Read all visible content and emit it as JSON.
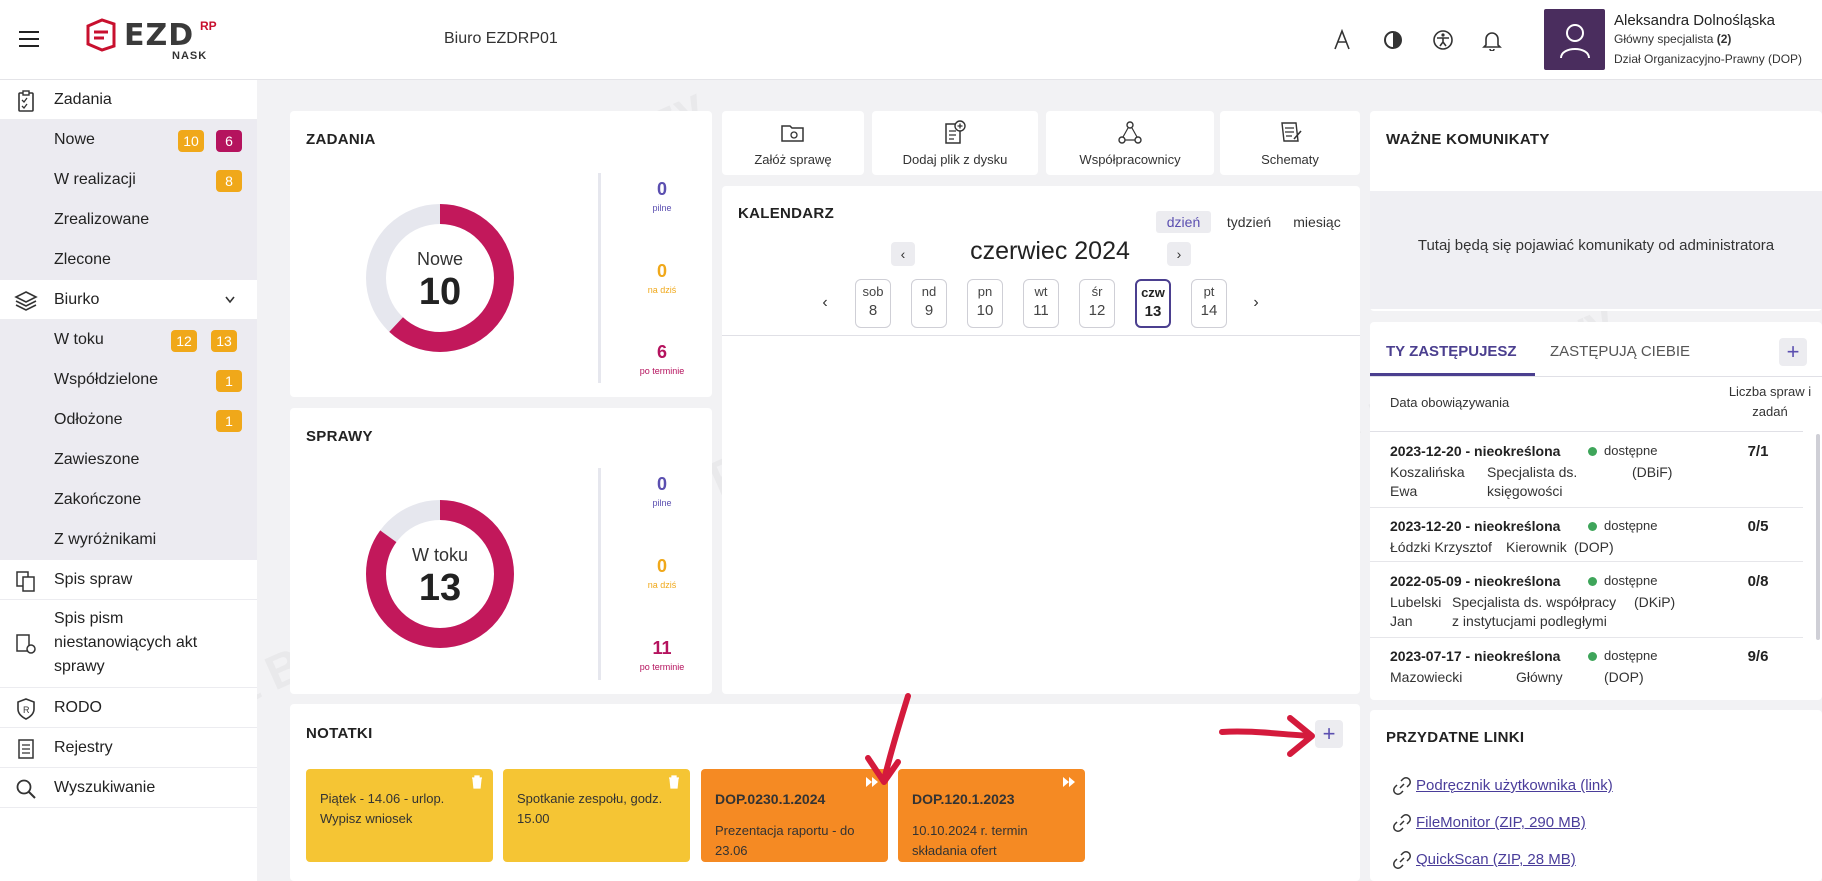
{
  "header": {
    "office": "Biuro EZDRP01",
    "logo_text": "EZD",
    "logo_rp": "RP",
    "logo_nask": "NASK",
    "user_name": "Aleksandra Dolnośląska",
    "user_role_prefix": "Główny specjalista ",
    "user_role_count": "(2)",
    "user_dept": "Dział Organizacyjno-Prawny (DOP)",
    "icons": [
      "font-size-icon",
      "contrast-icon",
      "accessibility-icon",
      "bell-icon"
    ]
  },
  "sidebar": {
    "zadania": "Zadania",
    "zadania_items": [
      {
        "label": "Nowe",
        "badge1": "10",
        "badge2": "6"
      },
      {
        "label": "W realizacji",
        "badge1": "8"
      },
      {
        "label": "Zrealizowane"
      },
      {
        "label": "Zlecone"
      }
    ],
    "biurko": "Biurko",
    "biurko_items": [
      {
        "label": "W toku",
        "badge1": "12",
        "badge2": "13"
      },
      {
        "label": "Współdzielone",
        "badge1": "1"
      },
      {
        "label": "Odłożone",
        "badge1": "1"
      },
      {
        "label": "Zawieszone"
      },
      {
        "label": "Zakończone"
      },
      {
        "label": "Z wyróżnikami"
      }
    ],
    "spis_spraw": "Spis spraw",
    "spis_pism_1": "Spis pism",
    "spis_pism_2": "niestanowiących akt",
    "spis_pism_3": "sprawy",
    "rodo": "RODO",
    "rejestry": "Rejestry",
    "wyszukiwanie": "Wyszukiwanie"
  },
  "zadania": {
    "title": "ZADANIA",
    "donut_label": "Nowe",
    "donut_value": "10",
    "donut_fraction": 0.62,
    "stats": [
      {
        "value": "0",
        "label": "pilne"
      },
      {
        "value": "0",
        "label": "na dziś"
      },
      {
        "value": "6",
        "label": "po terminie"
      }
    ]
  },
  "sprawy": {
    "title": "SPRAWY",
    "donut_label": "W toku",
    "donut_value": "13",
    "donut_fraction": 0.85,
    "stats": [
      {
        "value": "0",
        "label": "pilne"
      },
      {
        "value": "0",
        "label": "na dziś"
      },
      {
        "value": "11",
        "label": "po terminie"
      }
    ]
  },
  "quick_actions": [
    {
      "label": "Załóż sprawę"
    },
    {
      "label": "Dodaj plik z dysku"
    },
    {
      "label": "Współpracownicy"
    },
    {
      "label": "Schematy"
    }
  ],
  "kalendarz": {
    "title": "KALENDARZ",
    "views": [
      "dzień",
      "tydzień",
      "miesiąc"
    ],
    "month": "czerwiec 2024",
    "days": [
      {
        "name": "sob",
        "num": "8"
      },
      {
        "name": "nd",
        "num": "9"
      },
      {
        "name": "pn",
        "num": "10"
      },
      {
        "name": "wt",
        "num": "11"
      },
      {
        "name": "śr",
        "num": "12"
      },
      {
        "name": "czw",
        "num": "13"
      },
      {
        "name": "pt",
        "num": "14"
      }
    ]
  },
  "notatki": {
    "title": "NOTATKI",
    "notes": [
      {
        "line1": "Piątek - 14.06 - urlop.",
        "line2": "Wypisz wniosek"
      },
      {
        "line1": "Spotkanie zespołu, godz.",
        "line2": "15.00"
      },
      {
        "head": "DOP.0230.1.2024",
        "line1": "Prezentacja raportu - do",
        "line2": "23.06"
      },
      {
        "head": "DOP.120.1.2023",
        "line1": "10.10.2024 r. termin",
        "line2": "składania ofert"
      }
    ]
  },
  "komunikaty": {
    "title": "WAŻNE KOMUNIKATY",
    "message": "Tutaj będą się pojawiać komunikaty od administratora"
  },
  "zastepstwa": {
    "tab_active": "TY ZASTĘPUJESZ",
    "tab_other": "ZASTĘPUJĄ CIEBIE",
    "col_date": "Data obowiązywania",
    "col_count_1": "Liczba spraw i",
    "col_count_2": "zadań",
    "rows": [
      {
        "date": "2023-12-20 - nieokreślona",
        "status": "dostępne",
        "name1": "Koszalińska",
        "name2": "Ewa",
        "role1": "Specjalista ds.",
        "role2": "księgowości",
        "unit": "(DBiF)",
        "count": "7/1"
      },
      {
        "date": "2023-12-20 - nieokreślona",
        "status": "dostępne",
        "name1": "Łódzki Krzysztof",
        "role1": "Kierownik",
        "unit": "(DOP)",
        "count": "0/5"
      },
      {
        "date": "2022-05-09 - nieokreślona",
        "status": "dostępne",
        "name1": "Lubelski",
        "name2": "Jan",
        "role1": "Specjalista ds. współpracy",
        "role2": "z instytucjami podległymi",
        "unit": "(DKiP)",
        "count": "0/8"
      },
      {
        "date": "2023-07-17 - nieokreślona",
        "status": "dostępne",
        "name1": "Mazowiecki",
        "role1": "Główny",
        "unit": "(DOP)",
        "count": "9/6"
      }
    ]
  },
  "linki": {
    "title": "PRZYDATNE LINKI",
    "items": [
      "Podręcznik użytkownika (link)",
      "FileMonitor (ZIP, 290 MB)",
      "QuickScan (ZIP, 28 MB)"
    ]
  },
  "colors": {
    "magenta": "#c2185b",
    "yellow": "#f0a81a",
    "orange": "#f58a23",
    "purple": "#4b3f8f",
    "annotation_red": "#d41a3c"
  }
}
